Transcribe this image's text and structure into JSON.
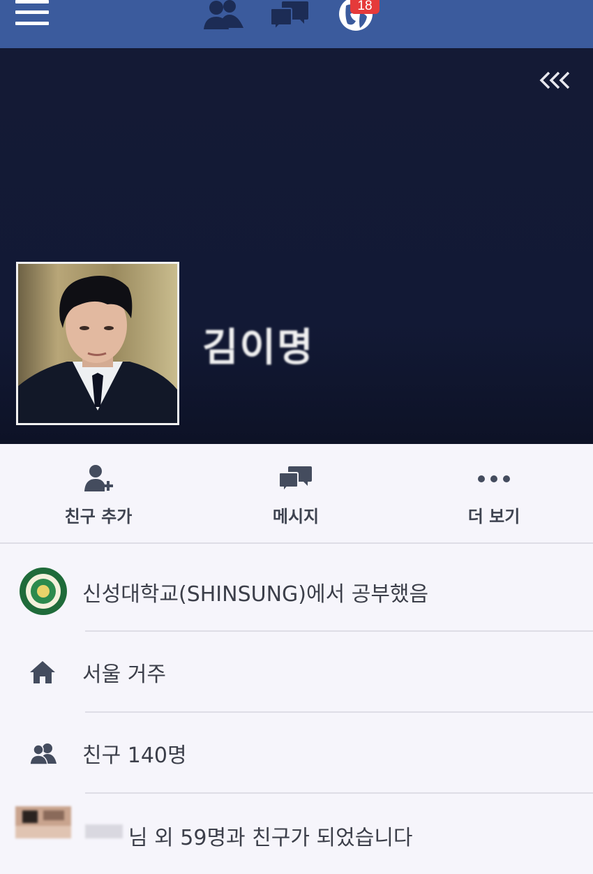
{
  "topbar": {
    "icons": [
      "menu-icon",
      "friend-requests-icon",
      "messages-icon",
      "notifications-globe-icon"
    ],
    "notification_count": "18",
    "color": "#3b5b9d"
  },
  "cover": {
    "collapse_icon": "triple-chevron-left-icon",
    "profile_name": "김이명"
  },
  "actions": [
    {
      "label": "친구 추가",
      "icon": "add-friend-icon"
    },
    {
      "label": "메시지",
      "icon": "message-icon"
    },
    {
      "label": "더 보기",
      "icon": "more-icon"
    }
  ],
  "about": {
    "education": "신성대학교(SHINSUNG)에서 공부했음",
    "lives_in": "서울 거주",
    "friends": "친구 140명",
    "mutual": "님 외 59명과 친구가 되었습니다"
  }
}
